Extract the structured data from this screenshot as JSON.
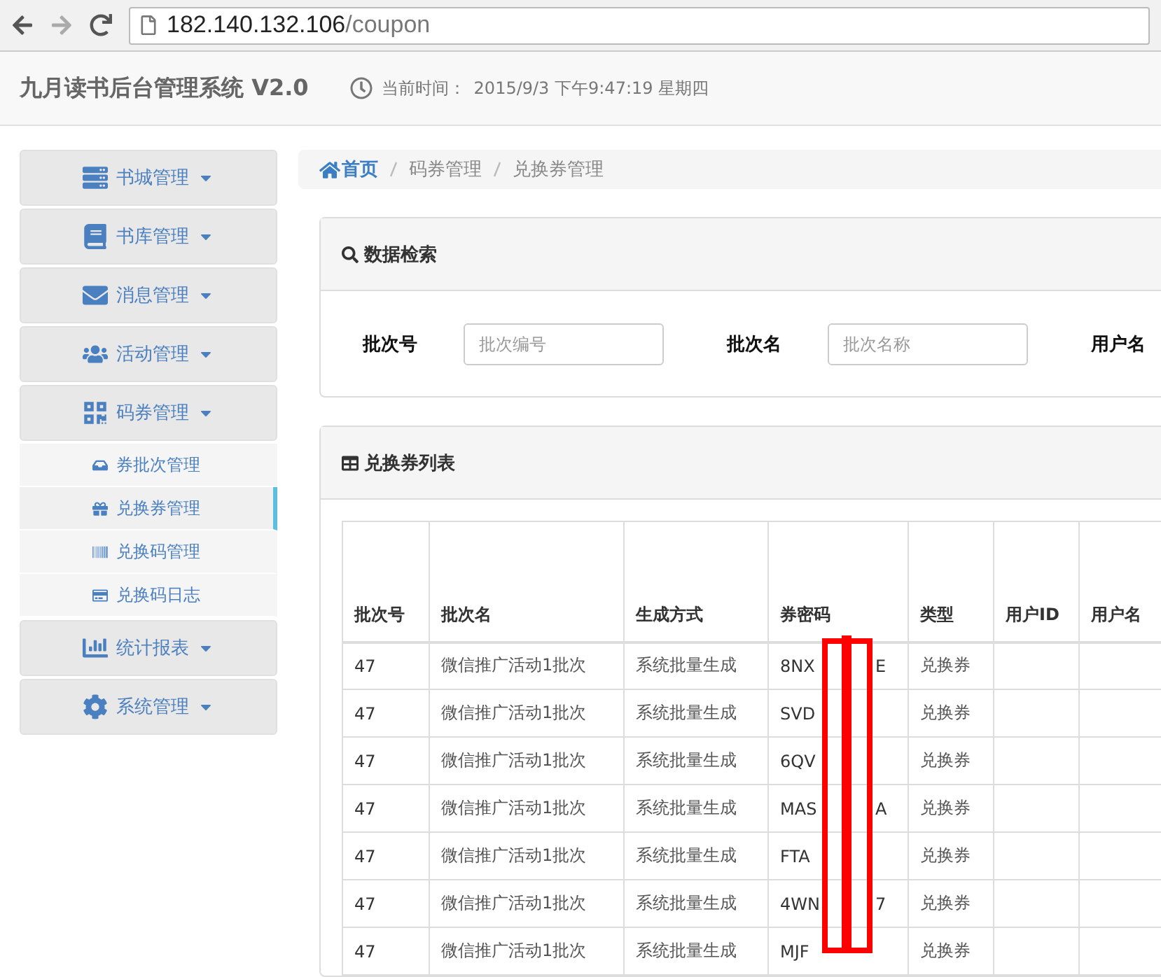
{
  "browser": {
    "url_host": "182.140.132.106",
    "url_path": "/coupon"
  },
  "header": {
    "title": "九月读书后台管理系统 V2.0",
    "clock_label": "当前时间：",
    "clock_value": "2015/9/3 下午9:47:19 星期四"
  },
  "sidebar": {
    "items": [
      {
        "label": "书城管理"
      },
      {
        "label": "书库管理"
      },
      {
        "label": "消息管理"
      },
      {
        "label": "活动管理"
      },
      {
        "label": "码券管理",
        "children": [
          {
            "label": "券批次管理",
            "selected": false
          },
          {
            "label": "兑换券管理",
            "selected": true
          },
          {
            "label": "兑换码管理",
            "selected": false
          },
          {
            "label": "兑换码日志",
            "selected": false
          }
        ]
      },
      {
        "label": "统计报表"
      },
      {
        "label": "系统管理"
      }
    ]
  },
  "breadcrumb": [
    "首页",
    "码券管理",
    "兑换券管理"
  ],
  "search_panel": {
    "title": "数据检索",
    "fields": [
      {
        "label": "批次号",
        "placeholder": "批次编号"
      },
      {
        "label": "批次名",
        "placeholder": "批次名称"
      },
      {
        "label": "用户名"
      }
    ]
  },
  "table_panel": {
    "title": "兑换券列表",
    "columns": [
      "批次号",
      "批次名",
      "生成方式",
      "券密码",
      "类型",
      "用户ID",
      "用户名"
    ],
    "rows": [
      {
        "batch": "47",
        "name": "微信推广活动1批次",
        "method": "系统批量生成",
        "code_head": "8NX",
        "code_tail": "E",
        "type": "兑换券"
      },
      {
        "batch": "47",
        "name": "微信推广活动1批次",
        "method": "系统批量生成",
        "code_head": "SVD",
        "type": "兑换券"
      },
      {
        "batch": "47",
        "name": "微信推广活动1批次",
        "method": "系统批量生成",
        "code_head": "6QV",
        "type": "兑换券"
      },
      {
        "batch": "47",
        "name": "微信推广活动1批次",
        "method": "系统批量生成",
        "code_head": "MAS",
        "code_tail": "A",
        "type": "兑换券"
      },
      {
        "batch": "47",
        "name": "微信推广活动1批次",
        "method": "系统批量生成",
        "code_head": "FTA",
        "type": "兑换券"
      },
      {
        "batch": "47",
        "name": "微信推广活动1批次",
        "method": "系统批量生成",
        "code_head": "4WN",
        "code_tail": "7",
        "type": "兑换券"
      },
      {
        "batch": "47",
        "name": "微信推广活动1批次",
        "method": "系统批量生成",
        "code_head": "MJF",
        "type": "兑换券"
      }
    ]
  }
}
